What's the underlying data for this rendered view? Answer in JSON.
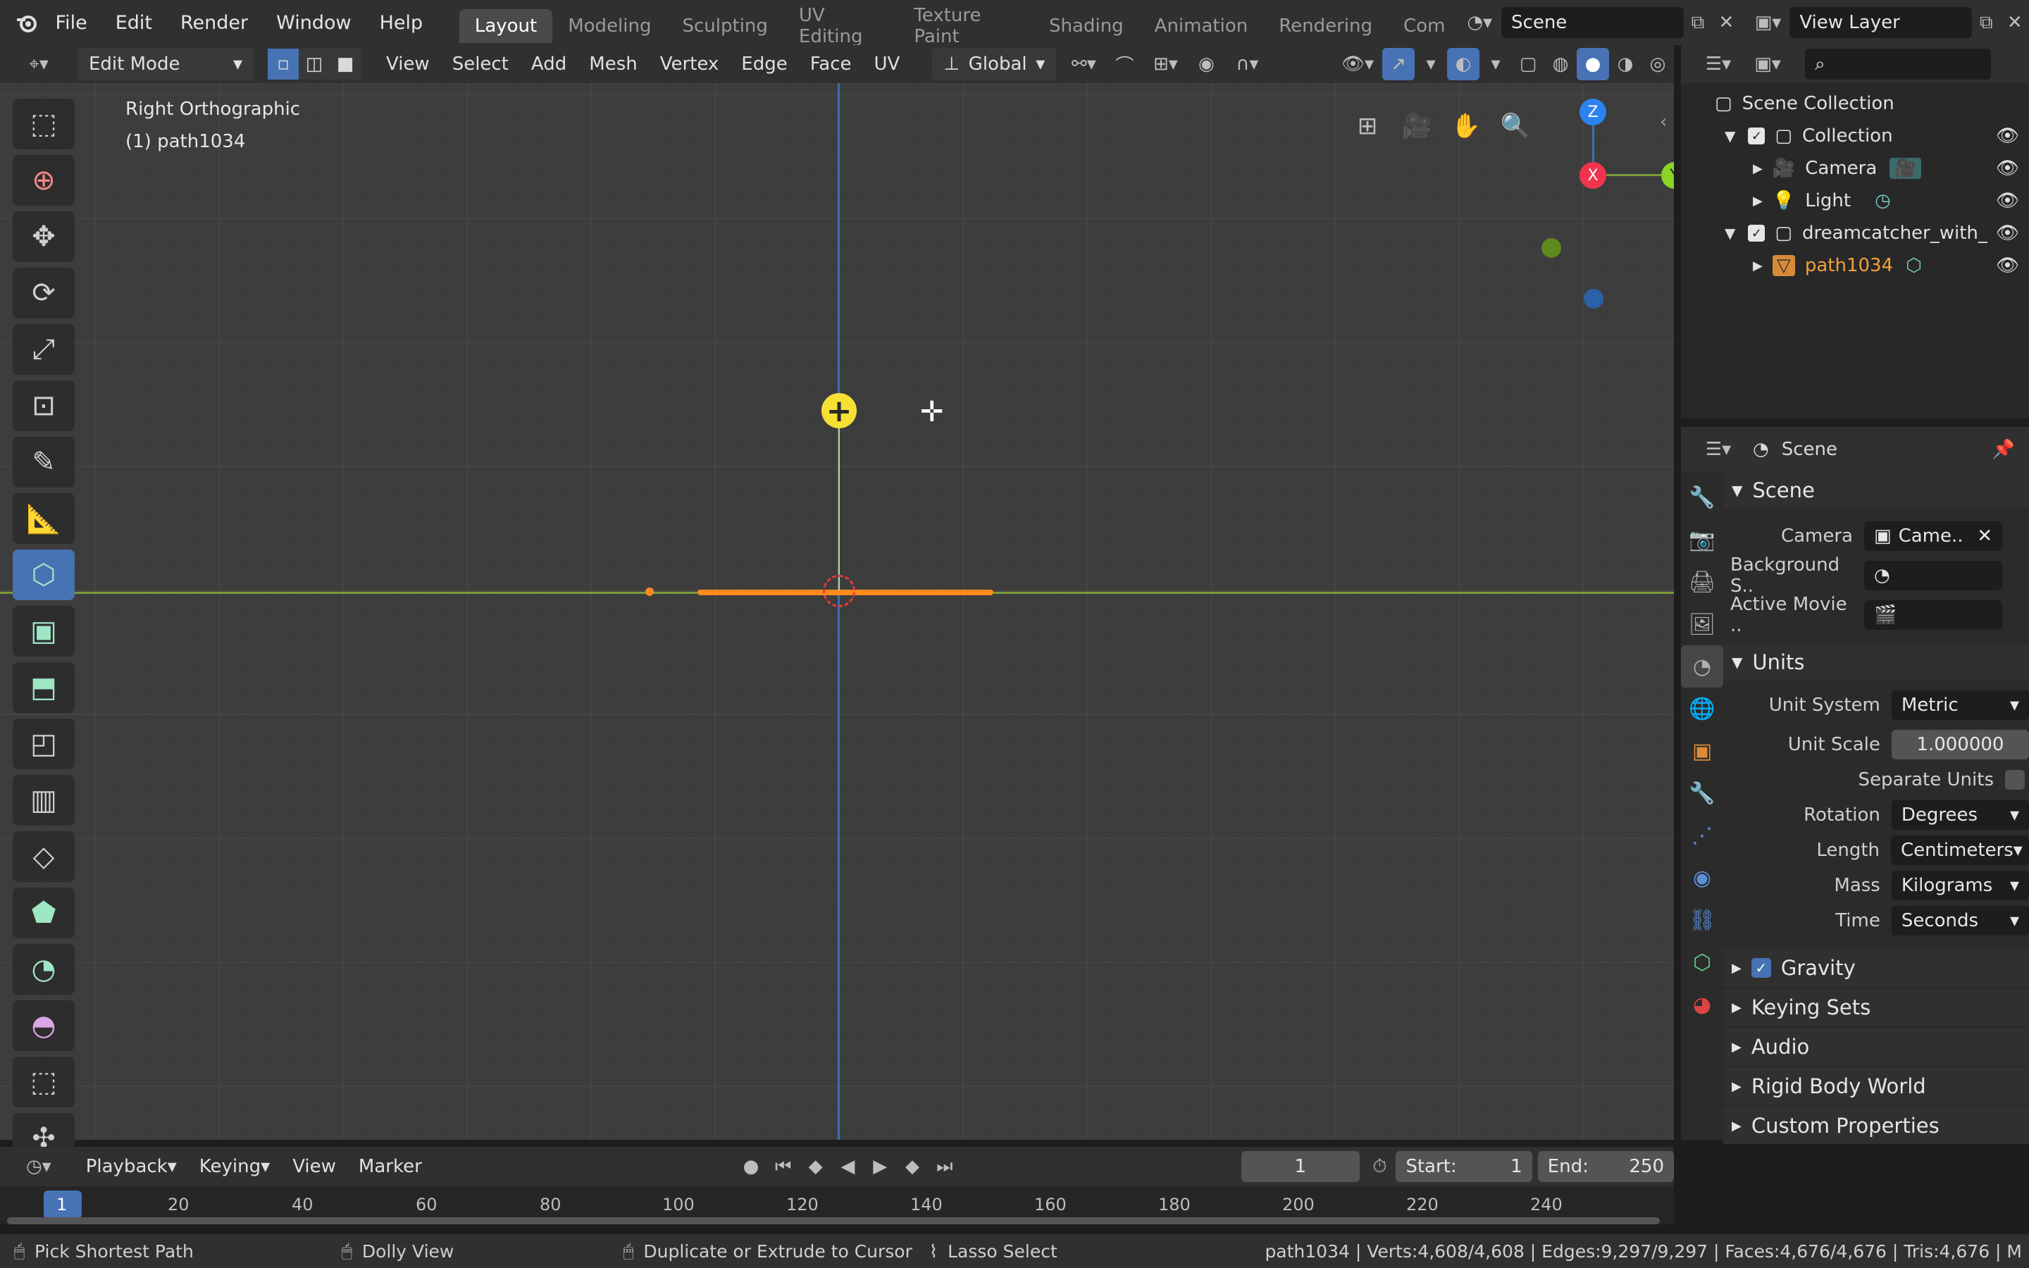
{
  "topbar": {
    "menus": [
      "File",
      "Edit",
      "Render",
      "Window",
      "Help"
    ],
    "workspaces": [
      "Layout",
      "Modeling",
      "Sculpting",
      "UV Editing",
      "Texture Paint",
      "Shading",
      "Animation",
      "Rendering",
      "Com"
    ],
    "scene": "Scene",
    "view_layer": "View Layer"
  },
  "vp_header": {
    "mode": "Edit Mode",
    "menus": [
      "View",
      "Select",
      "Add",
      "Mesh",
      "Vertex",
      "Edge",
      "Face",
      "UV"
    ],
    "transform_orientation": "Global"
  },
  "viewport": {
    "view_name": "Right Orthographic",
    "object_label": "(1) path1034",
    "gizmo": {
      "z": "Z",
      "x": "X",
      "y": "Y"
    }
  },
  "outliner": {
    "title": "Scene Collection",
    "items": [
      {
        "label": "Collection"
      },
      {
        "label": "Camera"
      },
      {
        "label": "Light"
      },
      {
        "label": "dreamcatcher_with_"
      },
      {
        "label": "path1034"
      }
    ]
  },
  "properties": {
    "context": "Scene",
    "scene_section": "Scene",
    "camera_label": "Camera",
    "camera_value": "Came..",
    "background_label": "Background S..",
    "movie_label": "Active Movie ..",
    "units_section": "Units",
    "unit_system_label": "Unit System",
    "unit_system": "Metric",
    "unit_scale_label": "Unit Scale",
    "unit_scale": "1.000000",
    "separate_units_label": "Separate Units",
    "rotation_label": "Rotation",
    "rotation": "Degrees",
    "length_label": "Length",
    "length": "Centimeters",
    "mass_label": "Mass",
    "mass": "Kilograms",
    "time_label": "Time",
    "time": "Seconds",
    "gravity": "Gravity",
    "keying_sets": "Keying Sets",
    "audio": "Audio",
    "rigid_body": "Rigid Body World",
    "custom_props": "Custom Properties"
  },
  "timeline": {
    "playback": "Playback",
    "keying": "Keying",
    "view": "View",
    "marker": "Marker",
    "current_frame": "1",
    "start_label": "Start:",
    "start": "1",
    "end_label": "End:",
    "end": "250",
    "ticks": [
      "1",
      "20",
      "40",
      "60",
      "80",
      "100",
      "120",
      "140",
      "160",
      "180",
      "200",
      "220",
      "240"
    ]
  },
  "statusbar": {
    "hint1": "Pick Shortest Path",
    "hint2": "Dolly View",
    "hint3": "Duplicate or Extrude to Cursor",
    "hint4": "Lasso Select",
    "stats": "path1034 | Verts:4,608/4,608 | Edges:9,297/9,297 | Faces:4,676/4,676 | Tris:4,676 | M"
  }
}
